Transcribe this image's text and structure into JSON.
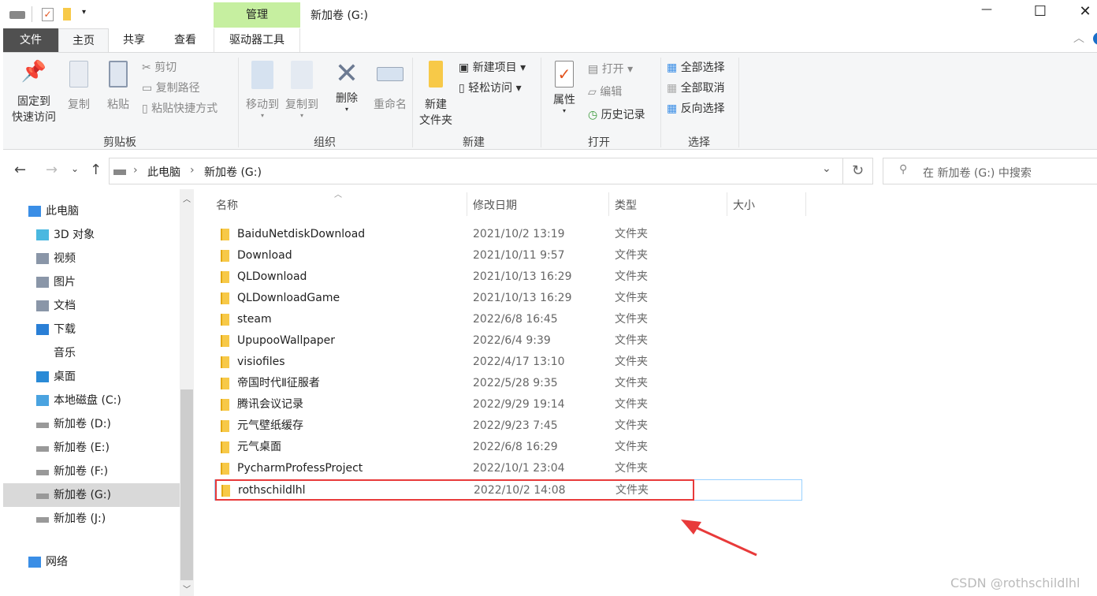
{
  "window": {
    "title": "新加卷 (G:)",
    "context_tab": "管理",
    "minimize": "—",
    "maximize": "☐",
    "close": "✕"
  },
  "tabs": [
    {
      "label": "文件"
    },
    {
      "label": "主页"
    },
    {
      "label": "共享"
    },
    {
      "label": "查看"
    },
    {
      "label": "驱动器工具"
    }
  ],
  "ribbon": {
    "clipboard": {
      "label": "剪贴板",
      "pin": "固定到\n快速访问",
      "pin1": "固定到",
      "pin2": "快速访问",
      "copy": "复制",
      "paste": "粘贴",
      "cut": "剪切",
      "copy_path": "复制路径",
      "paste_shortcut": "粘贴快捷方式"
    },
    "organize": {
      "label": "组织",
      "move_to": "移动到",
      "copy_to": "复制到",
      "delete": "删除",
      "rename": "重命名"
    },
    "new": {
      "label": "新建",
      "new_folder1": "新建",
      "new_folder2": "文件夹",
      "new_item": "新建项目",
      "easy_access": "轻松访问"
    },
    "open": {
      "label": "打开",
      "properties": "属性",
      "open": "打开",
      "edit": "编辑",
      "history": "历史记录"
    },
    "select": {
      "label": "选择",
      "select_all": "全部选择",
      "select_none": "全部取消",
      "invert": "反向选择"
    }
  },
  "address": {
    "crumbs": [
      "此电脑",
      "新加卷 (G:)"
    ],
    "search_placeholder": "在 新加卷 (G:) 中搜索"
  },
  "nav": [
    {
      "label": "此电脑",
      "icon": "computer-icon"
    },
    {
      "label": "3D 对象",
      "icon": "cube-icon"
    },
    {
      "label": "视频",
      "icon": "video-icon"
    },
    {
      "label": "图片",
      "icon": "picture-icon"
    },
    {
      "label": "文档",
      "icon": "document-icon"
    },
    {
      "label": "下载",
      "icon": "download-icon"
    },
    {
      "label": "音乐",
      "icon": "music-icon"
    },
    {
      "label": "桌面",
      "icon": "desktop-icon"
    },
    {
      "label": "本地磁盘 (C:)",
      "icon": "windows-drive-icon"
    },
    {
      "label": "新加卷 (D:)",
      "icon": "drive-icon"
    },
    {
      "label": "新加卷 (E:)",
      "icon": "drive-icon"
    },
    {
      "label": "新加卷 (F:)",
      "icon": "drive-icon"
    },
    {
      "label": "新加卷 (G:)",
      "icon": "drive-icon",
      "selected": true
    },
    {
      "label": "新加卷 (J:)",
      "icon": "drive-icon"
    },
    {
      "label": "网络",
      "icon": "network-icon"
    }
  ],
  "columns": {
    "name": "名称",
    "date": "修改日期",
    "type": "类型",
    "size": "大小"
  },
  "files": [
    {
      "name": "BaiduNetdiskDownload",
      "date": "2021/10/2 13:19",
      "type": "文件夹"
    },
    {
      "name": "Download",
      "date": "2021/10/11 9:57",
      "type": "文件夹"
    },
    {
      "name": "QLDownload",
      "date": "2021/10/13 16:29",
      "type": "文件夹"
    },
    {
      "name": "QLDownloadGame",
      "date": "2021/10/13 16:29",
      "type": "文件夹"
    },
    {
      "name": "steam",
      "date": "2022/6/8 16:45",
      "type": "文件夹"
    },
    {
      "name": "UpupooWallpaper",
      "date": "2022/6/4 9:39",
      "type": "文件夹"
    },
    {
      "name": "visiofiles",
      "date": "2022/4/17 13:10",
      "type": "文件夹"
    },
    {
      "name": "帝国时代Ⅱ征服者",
      "date": "2022/5/28 9:35",
      "type": "文件夹"
    },
    {
      "name": "腾讯会议记录",
      "date": "2022/9/29 19:14",
      "type": "文件夹"
    },
    {
      "name": "元气壁纸缓存",
      "date": "2022/9/23 7:45",
      "type": "文件夹"
    },
    {
      "name": "元气桌面",
      "date": "2022/6/8 16:29",
      "type": "文件夹"
    },
    {
      "name": "PycharmProfessProject",
      "date": "2022/10/1 23:04",
      "type": "文件夹"
    },
    {
      "name": "rothschildlhl",
      "date": "2022/10/2 14:08",
      "type": "文件夹",
      "highlighted": true
    }
  ],
  "watermark": "CSDN @rothschildlhl",
  "colors": {
    "highlight": "#e83a3a",
    "manage_tab": "#c6efa0",
    "selection": "#cce8ff"
  }
}
